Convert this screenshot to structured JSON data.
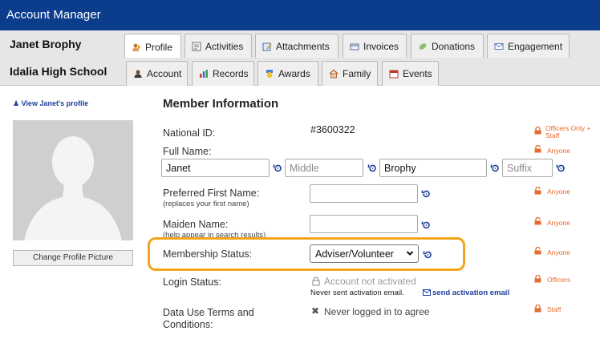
{
  "window": {
    "title": "Account Manager"
  },
  "member": {
    "name": "Janet Brophy",
    "school": "Idalia High School"
  },
  "tabs_row1": [
    {
      "label": "Profile",
      "icon": "profile-icon"
    },
    {
      "label": "Activities",
      "icon": "activities-icon"
    },
    {
      "label": "Attachments",
      "icon": "attachments-icon"
    },
    {
      "label": "Invoices",
      "icon": "invoices-icon"
    },
    {
      "label": "Donations",
      "icon": "donations-icon"
    },
    {
      "label": "Engagement",
      "icon": "engagement-icon"
    }
  ],
  "tabs_row2": [
    {
      "label": "Account",
      "icon": "account-icon"
    },
    {
      "label": "Records",
      "icon": "records-icon"
    },
    {
      "label": "Awards",
      "icon": "awards-icon"
    },
    {
      "label": "Family",
      "icon": "family-icon"
    },
    {
      "label": "Events",
      "icon": "events-icon"
    }
  ],
  "sidebar": {
    "view_profile": "View Janet's profile",
    "change_picture": "Change Profile Picture"
  },
  "section": {
    "title": "Member Information"
  },
  "fields": {
    "national_id": {
      "label": "National ID:",
      "value": "#3600322",
      "privacy": "Officers Only + Staff"
    },
    "full_name": {
      "label": "Full Name:",
      "first": "Janet",
      "middle_placeholder": "Middle",
      "last": "Brophy",
      "suffix_placeholder": "Suffix",
      "privacy": "Anyone"
    },
    "preferred": {
      "label": "Preferred First Name:",
      "help": "(replaces your first name)",
      "value": "",
      "privacy": "Anyone"
    },
    "maiden": {
      "label": "Maiden Name:",
      "help": "(help appear in search results)",
      "value": "",
      "privacy": "Anyone"
    },
    "membership": {
      "label": "Membership Status:",
      "selected": "Adviser/Volunteer",
      "privacy": "Anyone"
    },
    "login": {
      "label": "Login Status:",
      "status": "Account not activated",
      "note": "Never sent activation email.",
      "action": "send activation email",
      "privacy": "Officers"
    },
    "terms": {
      "label": "Data Use Terms and Conditions:",
      "status": "Never logged in to agree",
      "privacy": "Staff"
    }
  },
  "colors": {
    "header": "#0c3d8c",
    "privacy": "#e56b2e",
    "highlight": "#f2a51a",
    "link": "#1e3f9c"
  }
}
